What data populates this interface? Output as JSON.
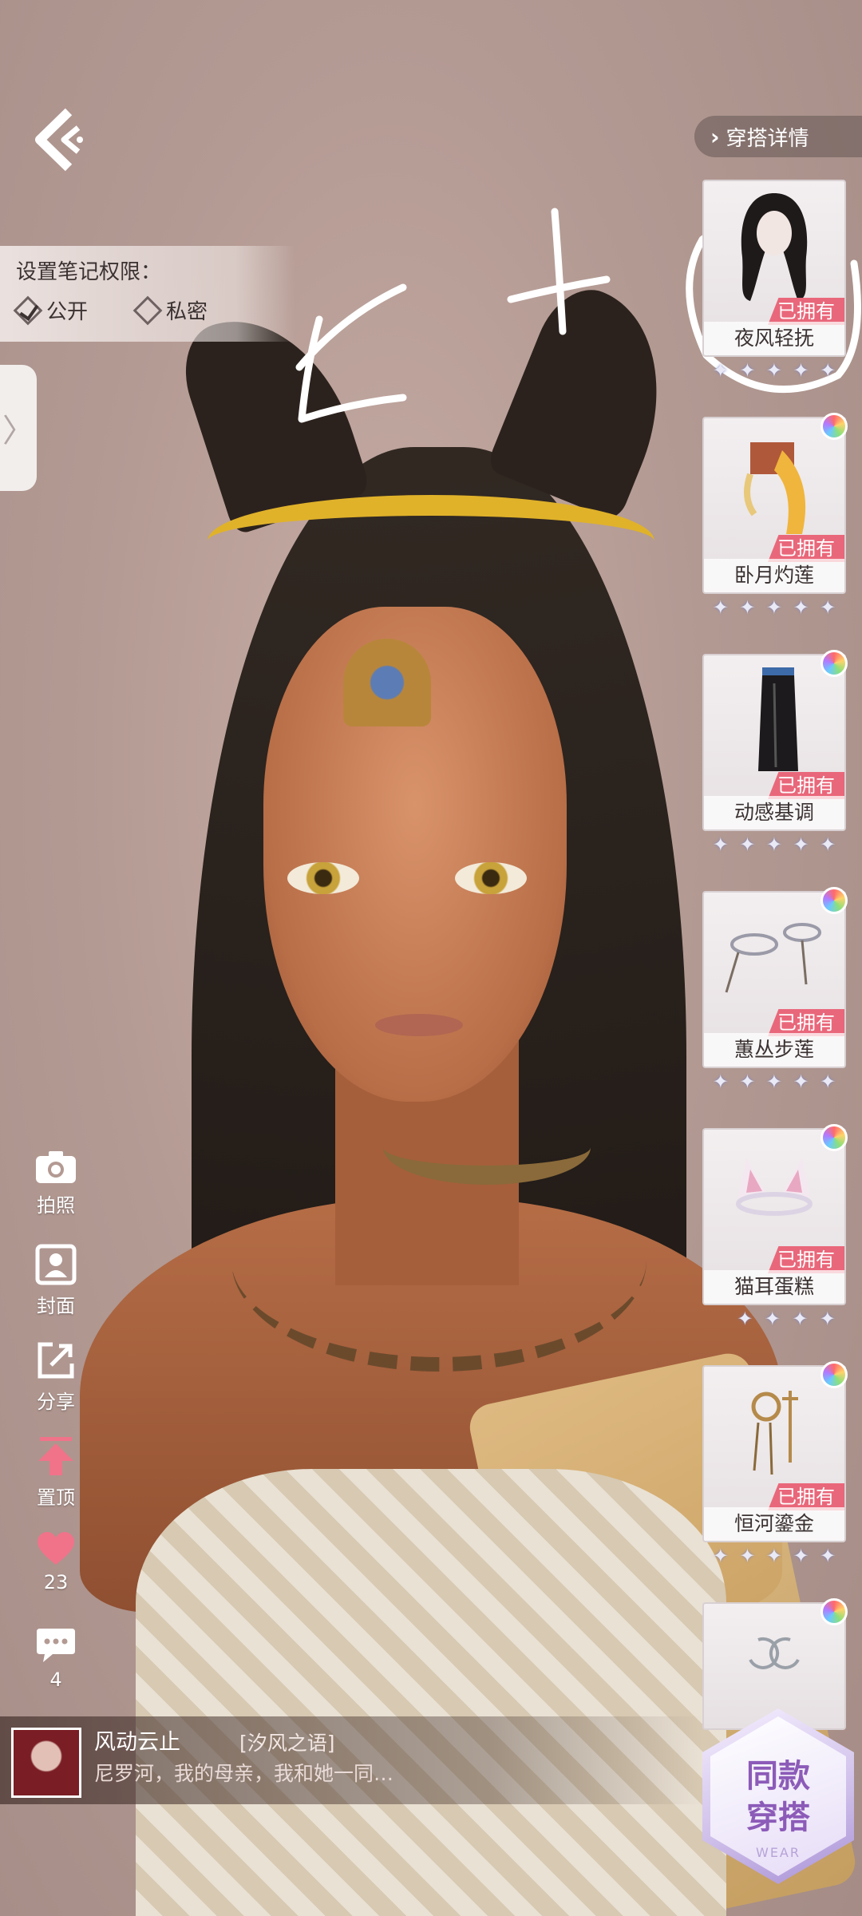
{
  "top": {
    "back_icon": "back-chevron-icon",
    "outfit_details_label": "穿搭详情"
  },
  "permission": {
    "title": "设置笔记权限：",
    "options": [
      {
        "label": "公开",
        "selected": true
      },
      {
        "label": "私密",
        "selected": false
      }
    ]
  },
  "items": [
    {
      "name": "夜风轻抚",
      "owned_label": "已拥有",
      "stars": 5,
      "rainbow_badge": false
    },
    {
      "name": "卧月灼莲",
      "owned_label": "已拥有",
      "stars": 5,
      "rainbow_badge": true
    },
    {
      "name": "动感基调",
      "owned_label": "已拥有",
      "stars": 5,
      "rainbow_badge": true
    },
    {
      "name": "蕙丛步莲",
      "owned_label": "已拥有",
      "stars": 5,
      "rainbow_badge": true
    },
    {
      "name": "猫耳蛋糕",
      "owned_label": "已拥有",
      "stars": 4,
      "rainbow_badge": true
    },
    {
      "name": "恒河鎏金",
      "owned_label": "已拥有",
      "stars": 5,
      "rainbow_badge": true
    },
    {
      "name": "",
      "owned_label": "",
      "stars": 0,
      "rainbow_badge": true
    }
  ],
  "actions": {
    "photo": {
      "label": "拍照",
      "icon": "camera-icon"
    },
    "cover": {
      "label": "封面",
      "icon": "portrait-icon"
    },
    "share": {
      "label": "分享",
      "icon": "share-icon"
    },
    "pin": {
      "label": "置顶",
      "icon": "pin-arrow-icon"
    },
    "like": {
      "count": "23",
      "icon": "heart-icon"
    },
    "comment": {
      "count": "4",
      "icon": "speech-bubble-icon"
    }
  },
  "comment": {
    "username": "风动云止",
    "tag": "[汐风之语]",
    "text": "尼罗河，我的母亲，我和她一同…"
  },
  "same_outfit": {
    "line1": "同款",
    "line2": "穿搭",
    "watermark": "WEAR"
  },
  "colors": {
    "owned_badge": "#e9677a",
    "pin_arrow": "#f0738a",
    "heart": "#f0738a",
    "same_outfit_text": "#8c5bb8"
  }
}
